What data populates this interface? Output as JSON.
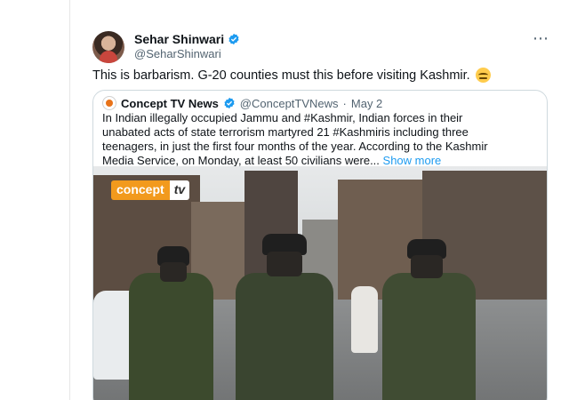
{
  "tweet": {
    "display_name": "Sehar Shinwari",
    "handle": "@SeharShinwari",
    "text": "This is barbarism. G-20 counties must this before visiting Kashmir.",
    "more_icon": "more-horizontal-icon",
    "emoji_icon": "rolling-eyes-emoji-icon"
  },
  "quoted_tweet": {
    "display_name": "Concept TV News",
    "handle": "@ConceptTVNews",
    "separator": "·",
    "date": "May 2",
    "lines": [
      "In Indian illegally occupied Jammu and #Kashmir, Indian forces in their",
      "unabated acts of state terrorism martyred 21 #Kashmiris including three",
      "teenagers, in just the first four months of the year. According to the Kashmir",
      "Media Service, on Monday, at least 50 civilians were..."
    ],
    "show_more": "Show more",
    "media_watermark_a": "concept",
    "media_watermark_b": "tv"
  },
  "colors": {
    "link": "#1d9bf0",
    "verified": "#1d9bf0",
    "secondary_text": "#536471",
    "border": "#cfd9de"
  }
}
